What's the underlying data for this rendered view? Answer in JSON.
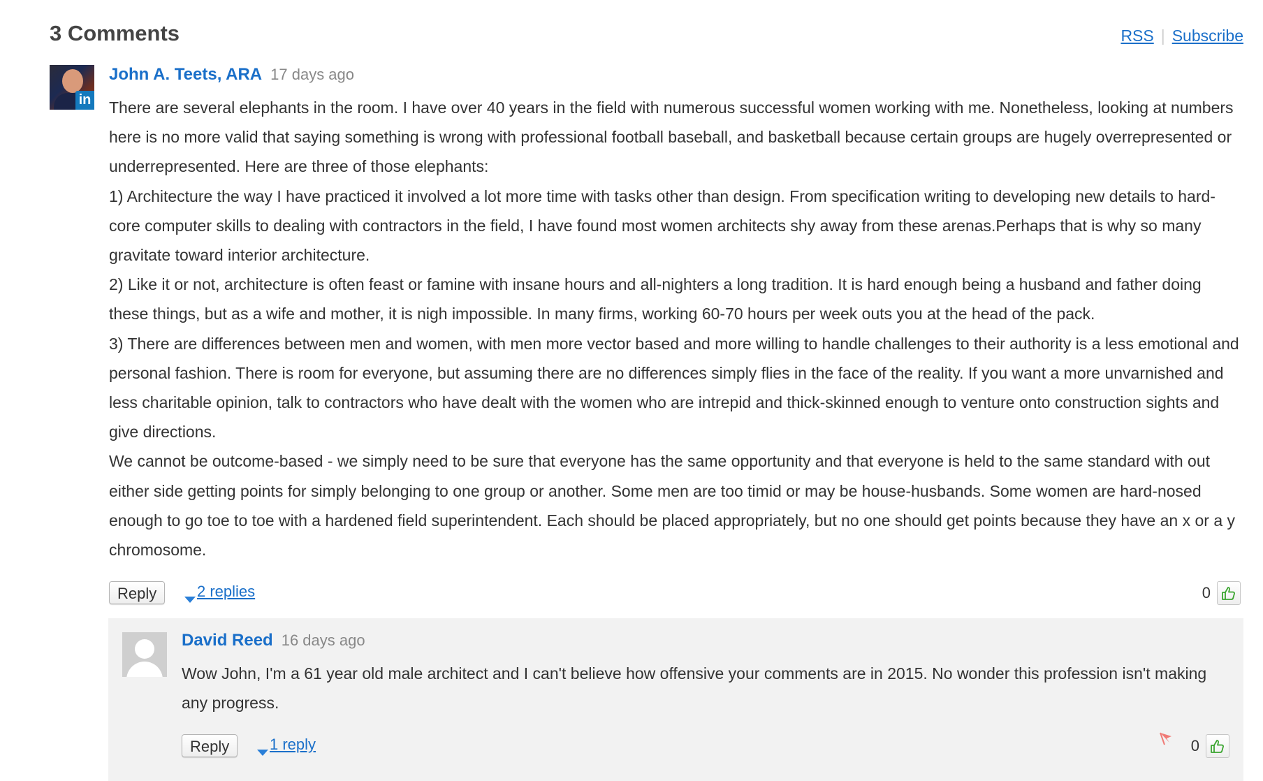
{
  "header": {
    "title": "3 Comments",
    "rss_label": "RSS",
    "separator": "|",
    "subscribe_label": "Subscribe"
  },
  "comment": {
    "author": "John A. Teets, ARA",
    "time": "17 days ago",
    "badge_letter": "in",
    "paragraphs": [
      "There are several elephants in the room. I have over 40 years in the field with numerous successful women working with me. Nonetheless, looking at numbers here is no more valid that saying something is wrong with professional football baseball, and basketball because certain groups are hugely overrepresented or underrepresented. Here are three of those elephants:",
      "1) Architecture the way I have practiced it involved a lot more time with tasks other than design. From specification writing to developing new details to hard-core computer skills to dealing with contractors in the field, I have found most women architects shy away from these arenas.Perhaps that is why so many gravitate toward interior architecture.",
      "2) Like it or not, architecture is often feast or famine with insane hours and all-nighters a long tradition. It is hard enough being a husband and father doing these things, but as a wife and mother, it is nigh impossible. In many firms, working 60-70 hours per week outs you at the head of the pack.",
      "3) There are differences between men and women, with men more vector based and more willing to handle challenges to their authority is a less emotional and personal fashion. There is room for everyone, but assuming there are no differences simply flies in the face of the reality. If you want a more unvarnished and less charitable opinion, talk to contractors who have dealt with the women who are intrepid and thick-skinned enough to venture onto construction sights and give directions.",
      "We cannot be outcome-based - we simply need to be sure that everyone has the same opportunity and that everyone is held to the same standard with out either side getting points for simply belonging to one group or another. Some men are too timid or may be house-husbands. Some women are hard-nosed enough to go toe to toe with a hardened field superintendent. Each should be placed appropriately, but no one should get points because they have an x or a y chromosome."
    ],
    "reply_label": "Reply",
    "replies_label": "2 replies",
    "votes": "0"
  },
  "reply": {
    "author": "David Reed",
    "time": "16 days ago",
    "text": "Wow John, I'm a 61 year old male architect and I can't believe how offensive your comments are in 2015. No wonder this profession isn't making any progress.",
    "reply_label": "Reply",
    "replies_label": "1 reply",
    "votes": "0"
  },
  "icons": {
    "linkedin": "linkedin-badge-icon",
    "thumbs_up": "thumbs-up-icon",
    "flag": "flag-icon",
    "expand": "caret-down-icon",
    "default_avatar": "default-avatar-icon"
  },
  "colors": {
    "link": "#1a6fc9",
    "meta": "#888888",
    "reply_bg": "#f2f2f2",
    "thumbs_up": "#3aa52f",
    "flag": "#f07a76",
    "linkedin": "#1479bd"
  }
}
